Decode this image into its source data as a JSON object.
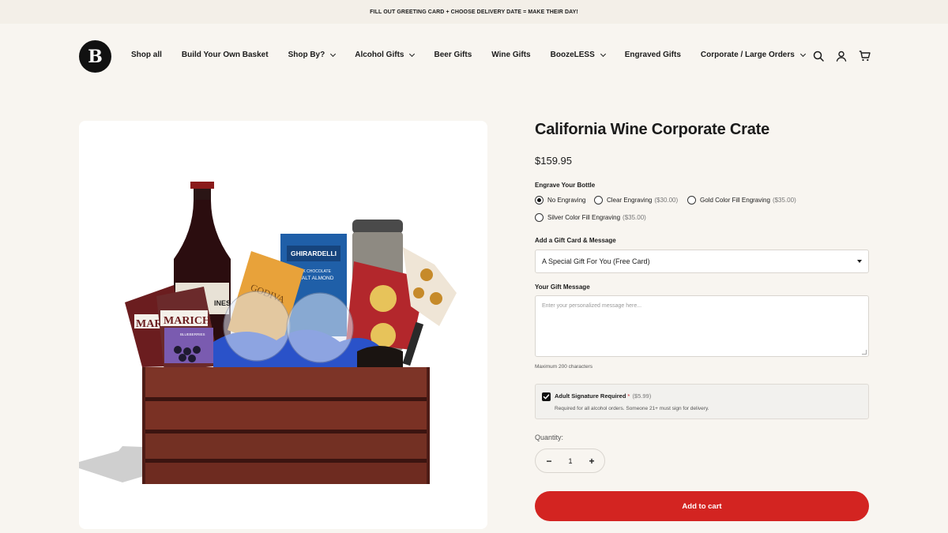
{
  "announcement": "FILL OUT GREETING CARD + CHOOSE DELIVERY DATE = MAKE THEIR DAY!",
  "header": {
    "logo_text": "B",
    "nav": [
      {
        "label": "Shop all",
        "dropdown": false
      },
      {
        "label": "Build Your Own Basket",
        "dropdown": false
      },
      {
        "label": "Shop By?",
        "dropdown": true
      },
      {
        "label": "Alcohol Gifts",
        "dropdown": true
      },
      {
        "label": "Beer Gifts",
        "dropdown": false
      },
      {
        "label": "Wine Gifts",
        "dropdown": false
      },
      {
        "label": "BoozeLESS",
        "dropdown": true
      },
      {
        "label": "Engraved Gifts",
        "dropdown": false
      },
      {
        "label": "Corporate / Large Orders",
        "dropdown": true
      }
    ],
    "icons": [
      "search-icon",
      "account-icon",
      "cart-icon"
    ]
  },
  "product": {
    "title": "California Wine Corporate Crate",
    "price": "$159.95",
    "image_labels": {
      "ghirardelli_brand": "GHIRARDELLI",
      "ghirardelli_line1": "MILK CHOCOLATE",
      "ghirardelli_line2": "SALT ALMOND",
      "godiva": "GODIVA",
      "marich": "MARICH",
      "marich_partial": "MAR",
      "blueberries": "BLUEBERRIES",
      "wine_label": "INES"
    },
    "engrave": {
      "label": "Engrave Your Bottle",
      "options": [
        {
          "label": "No Engraving",
          "addon": "",
          "selected": true
        },
        {
          "label": "Clear Engraving",
          "addon": "($30.00)",
          "selected": false
        },
        {
          "label": "Gold Color Fill Engraving",
          "addon": "($35.00)",
          "selected": false
        },
        {
          "label": "Silver Color Fill Engraving",
          "addon": "($35.00)",
          "selected": false
        }
      ]
    },
    "gift_card": {
      "label": "Add a Gift Card & Message",
      "selected": "A Special Gift For You (Free Card)"
    },
    "gift_message": {
      "label": "Your Gift Message",
      "placeholder": "Enter your personalized message here...",
      "help": "Maximum 200 characters"
    },
    "signature": {
      "label": "Adult Signature Required",
      "required_mark": "*",
      "addon": "($5.99)",
      "note": "Required for all alcohol orders. Someone 21+ must sign for delivery.",
      "checked": true
    },
    "quantity": {
      "label": "Quantity:",
      "value": "1",
      "minus": "−",
      "plus": "+"
    },
    "add_to_cart": "Add to cart"
  },
  "colors": {
    "background": "#f8f5f0",
    "accent_red": "#d32421",
    "text": "#1b1b1b"
  }
}
